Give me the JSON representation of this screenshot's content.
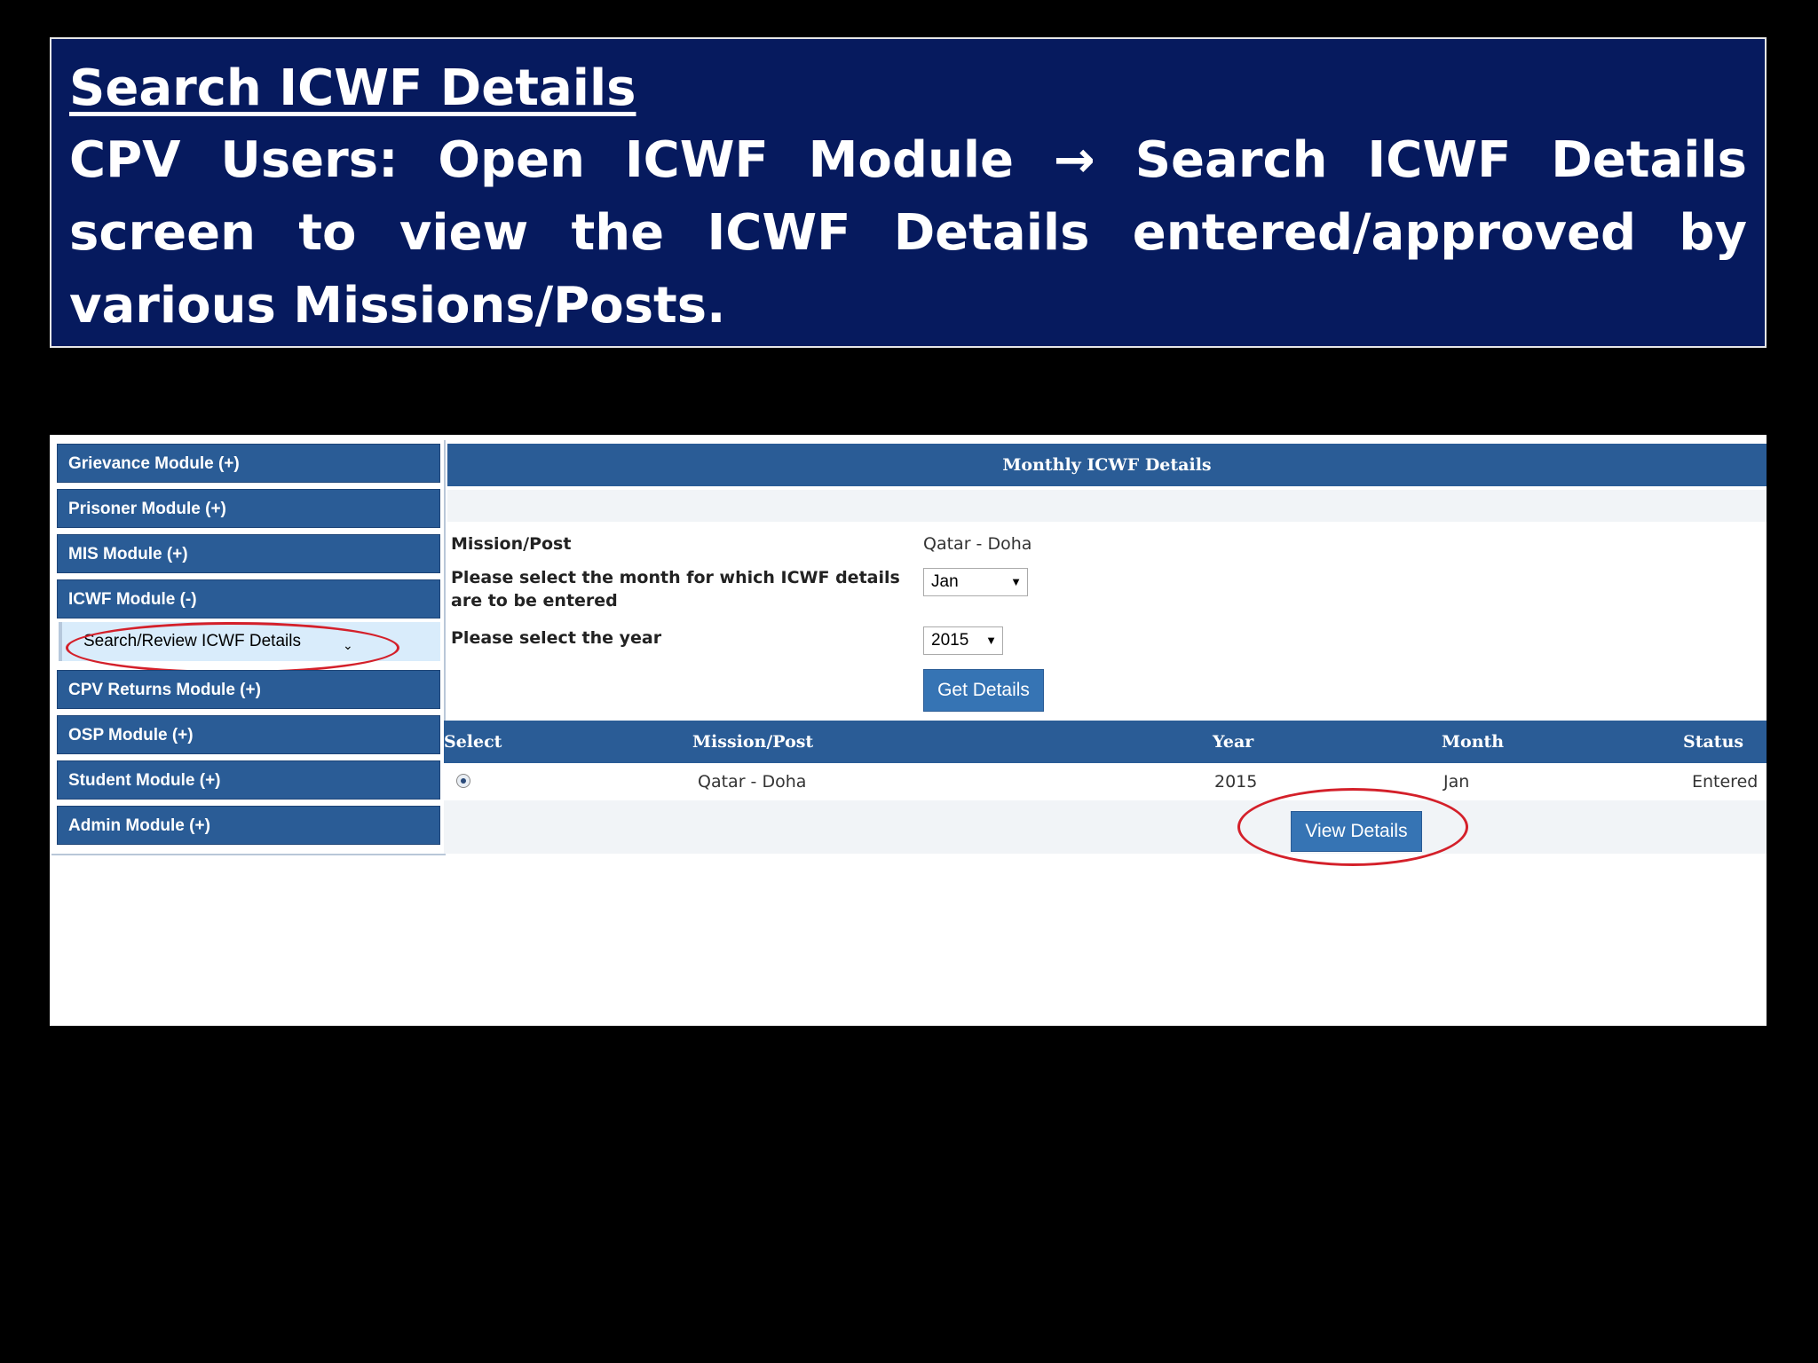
{
  "slide": {
    "title": "Search ICWF Details",
    "text_before_arrow": "CPV Users: Open ICWF Module ",
    "arrow_icon": "→",
    "text_after_arrow": " Search ICWF Details screen to view the ICWF Details entered/approved by various Missions/Posts."
  },
  "sidebar": {
    "items": [
      {
        "label": "Grievance Module (+)"
      },
      {
        "label": "Prisoner Module (+)"
      },
      {
        "label": "MIS Module (+)"
      },
      {
        "label": "ICWF Module (-)"
      },
      {
        "label": "CPV Returns Module (+)"
      },
      {
        "label": "OSP Module (+)"
      },
      {
        "label": "Student Module (+)"
      },
      {
        "label": "Admin Module (+)"
      }
    ],
    "sub_item": {
      "label": "Search/Review ICWF Details",
      "caret": "⌄"
    }
  },
  "main": {
    "header": "Monthly ICWF Details",
    "mission_label": "Mission/Post",
    "mission_value": "Qatar - Doha",
    "month_label": "Please select the month for which ICWF details are to be entered",
    "month_value": "Jan",
    "year_label": "Please select the year",
    "year_value": "2015",
    "get_details_label": "Get Details",
    "table": {
      "headers": [
        "Select",
        "Mission/Post",
        "Year",
        "Month",
        "Status"
      ],
      "rows": [
        {
          "mission": "Qatar - Doha",
          "year": "2015",
          "month": "Jan",
          "status": "Entered"
        }
      ]
    },
    "view_details_label": "View Details"
  },
  "colors": {
    "banner_bg": "#061a5e",
    "header_blue": "#2a5c96",
    "button_blue": "#3674b4",
    "highlight_red": "#d4202a"
  }
}
